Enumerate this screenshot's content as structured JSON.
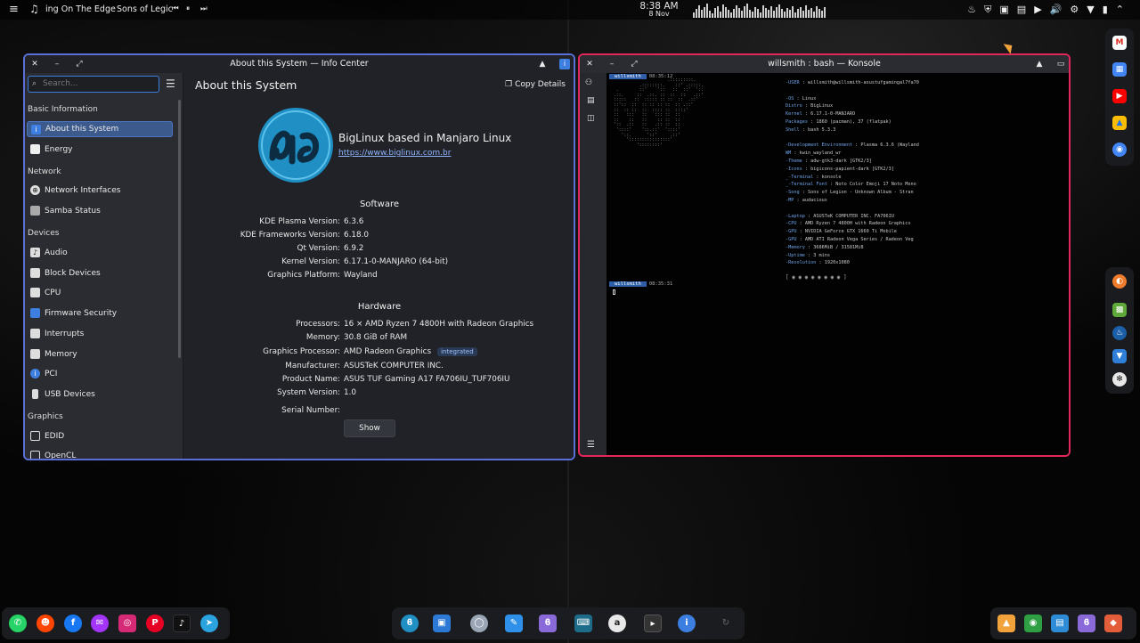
{
  "topbar": {
    "song": "ing On The Edge",
    "artist": "Sons of Legic",
    "time": "8:38 AM",
    "date": "8 Nov"
  },
  "infocenter": {
    "title": "About this System — Info Center",
    "search_placeholder": "Search...",
    "page_title": "About this System",
    "copy_details": "Copy Details",
    "sections": [
      {
        "label": "Basic Information",
        "items": [
          "About this System",
          "Energy"
        ]
      },
      {
        "label": "Network",
        "items": [
          "Network Interfaces",
          "Samba Status"
        ]
      },
      {
        "label": "Devices",
        "items": [
          "Audio",
          "Block Devices",
          "CPU",
          "Firmware Security",
          "Interrupts",
          "Memory",
          "PCI",
          "USB Devices"
        ]
      },
      {
        "label": "Graphics",
        "items": [
          "EDID",
          "OpenCL"
        ]
      }
    ],
    "brand": "BigLinux based in Manjaro Linux",
    "brand_url": "https://www.biglinux.com.br",
    "software_heading": "Software",
    "software": [
      {
        "k": "KDE Plasma Version:",
        "v": "6.3.6"
      },
      {
        "k": "KDE Frameworks Version:",
        "v": "6.18.0"
      },
      {
        "k": "Qt Version:",
        "v": "6.9.2"
      },
      {
        "k": "Kernel Version:",
        "v": "6.17.1-0-MANJARO (64-bit)"
      },
      {
        "k": "Graphics Platform:",
        "v": "Wayland"
      }
    ],
    "hardware_heading": "Hardware",
    "hardware": [
      {
        "k": "Processors:",
        "v": "16 × AMD Ryzen 7 4800H with Radeon Graphics"
      },
      {
        "k": "Memory:",
        "v": "30.8 GiB of RAM"
      },
      {
        "k": "Graphics Processor:",
        "v": "AMD Radeon Graphics",
        "badge": "integrated"
      },
      {
        "k": "Manufacturer:",
        "v": "ASUSTeK COMPUTER INC."
      },
      {
        "k": "Product Name:",
        "v": "ASUS TUF Gaming A17 FA706IU_TUF706IU"
      },
      {
        "k": "System Version:",
        "v": "1.0"
      },
      {
        "k": "Serial Number:",
        "v": ""
      }
    ],
    "show_button": "Show"
  },
  "konsole": {
    "title": "willsmith : bash — Konsole",
    "prompt_user": "willsmith",
    "prompt_time1": "08:35:12",
    "prompt_time2": "08:35:31",
    "fetch": [
      {
        "label": "-USER",
        "value": ": willsmith@willsmith-asustufgamingal7fa70"
      },
      {
        "label": "",
        "value": ""
      },
      {
        "label": "-OS",
        "value": ": Linux"
      },
      {
        "label": "Distro",
        "value": ": BigLinux"
      },
      {
        "label": "Kernel",
        "value": ": 6.17.1-0-MANJARO"
      },
      {
        "label": "Packages",
        "value": ": 1860 (pacman), 37 (flatpak)"
      },
      {
        "label": "Shell",
        "value": ": bash 5.3.3"
      },
      {
        "label": "",
        "value": ""
      },
      {
        "label": "-Development Environment",
        "value": ": Plasma 6.3.6 (Wayland"
      },
      {
        "label": "WM",
        "value": ": kwin_wayland_wr"
      },
      {
        "label": "-Theme",
        "value": ": adw-gtk3-dark [GTK2/3]"
      },
      {
        "label": "-Icons",
        "value": ": bigicons-papient-dark [GTK2/3]"
      },
      {
        "label": "_-Terminal",
        "value": ": konsole"
      },
      {
        "label": "_-Terminal Font",
        "value": ": Noto Color Emoji 17 Noto Mono"
      },
      {
        "label": "-Song",
        "value": ": Sons of Legion - Unknown Album - Stran"
      },
      {
        "label": "-MP",
        "value": ": audacious"
      },
      {
        "label": "",
        "value": ""
      },
      {
        "label": "-Laptop",
        "value": ": ASUSTeK COMPUTER INC. FA706IU"
      },
      {
        "label": "-CPU",
        "value": ": AMD Ryzen 7 4800H with Radeon Graphics"
      },
      {
        "label": "-GPU",
        "value": ": NVIDIA GeForce GTX 1660 Ti Mobile"
      },
      {
        "label": "-GPU",
        "value": ": AMD ATI Radeon Vega Series / Radeon Veg"
      },
      {
        "label": "-Memory",
        "value": ": 3686MiB / 31581MiB"
      },
      {
        "label": "-Uptime",
        "value": ": 3 mins"
      },
      {
        "label": "-Resolution",
        "value": ": 1920x1080"
      }
    ]
  }
}
